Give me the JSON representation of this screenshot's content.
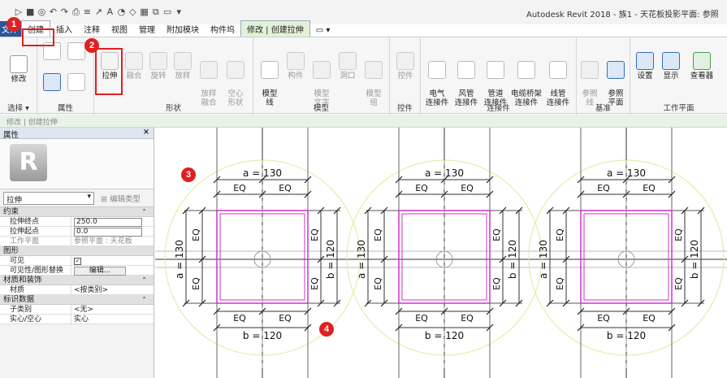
{
  "titlebar": {
    "qat_glyphs": [
      "▷",
      "■",
      "◎",
      "↶",
      "↷",
      "⎙",
      "≡",
      "↗",
      "A",
      "◔",
      "◇",
      "▦",
      "⧉",
      "▭",
      "▾"
    ],
    "app_title": "Autodesk Revit 2018 -    族1 - 天花板投影平面: 参照"
  },
  "tabs": [
    {
      "label": "文件",
      "active": false
    },
    {
      "label": "创建",
      "active": true
    },
    {
      "label": "插入",
      "active": false
    },
    {
      "label": "注释",
      "active": false
    },
    {
      "label": "视图",
      "active": false
    },
    {
      "label": "管理",
      "active": false
    },
    {
      "label": "附加模块",
      "active": false
    },
    {
      "label": "构件坞",
      "active": false
    },
    {
      "label": "修改 | 创建拉伸",
      "active": false
    },
    {
      "label": "▭ ▾",
      "active": false
    }
  ],
  "ribbon": {
    "select": {
      "tool": "修改",
      "label": "选择 ▾"
    },
    "properties": {
      "label": "属性"
    },
    "forms": {
      "tools": [
        "拉伸",
        "融合",
        "旋转",
        "放样",
        "放样\n融合",
        "空心\n形状"
      ],
      "label": "形状"
    },
    "model": {
      "tools": [
        "模型\n线",
        "构件",
        "模型\n文字",
        "洞口",
        "模型\n组"
      ],
      "label": "模型"
    },
    "control": {
      "tools": [
        "控件"
      ],
      "label": "控件"
    },
    "connectors": {
      "tools": [
        "电气\n连接件",
        "风管\n连接件",
        "管道\n连接件",
        "电缆桥架\n连接件",
        "线管\n连接件"
      ],
      "label": "连接件"
    },
    "datum": {
      "tools": [
        "参照\n线",
        "参照\n平面"
      ],
      "label": "基准"
    },
    "workplane": {
      "tools": [
        "设置",
        "显示",
        "查看器"
      ],
      "label": "工作平面"
    }
  },
  "options_bar": "修改 | 创建拉伸",
  "properties": {
    "title": "属性",
    "logo": "R",
    "type_selector": "拉伸",
    "edit_type": "编辑类型",
    "categories": [
      {
        "name": "约束",
        "rows": [
          {
            "k": "拉伸终点",
            "v": "250.0",
            "kind": "input"
          },
          {
            "k": "拉伸起点",
            "v": "0.0",
            "kind": "input"
          },
          {
            "k": "工作平面",
            "v": "参照平面 : 天花板",
            "kind": "dim"
          }
        ]
      },
      {
        "name": "图形",
        "rows": [
          {
            "k": "可见",
            "v": "✓",
            "kind": "check"
          },
          {
            "k": "可见性/图形替换",
            "v": "编辑...",
            "kind": "button"
          }
        ]
      },
      {
        "name": "材质和装饰",
        "rows": [
          {
            "k": "材质",
            "v": "<按类别>",
            "kind": "text"
          }
        ]
      },
      {
        "name": "标识数据",
        "rows": [
          {
            "k": "子类别",
            "v": "<无>",
            "kind": "text"
          },
          {
            "k": "实心/空心",
            "v": "实心",
            "kind": "text"
          }
        ]
      }
    ]
  },
  "canvas": {
    "dim_a": "a = 130",
    "dim_b": "b = 120",
    "eq": "EQ"
  },
  "callouts": [
    "1",
    "2",
    "3",
    "4"
  ],
  "colors": {
    "highlight": "#e02020",
    "extrusion_sketch": "#cc33cc",
    "ref_plane": "#333333"
  }
}
